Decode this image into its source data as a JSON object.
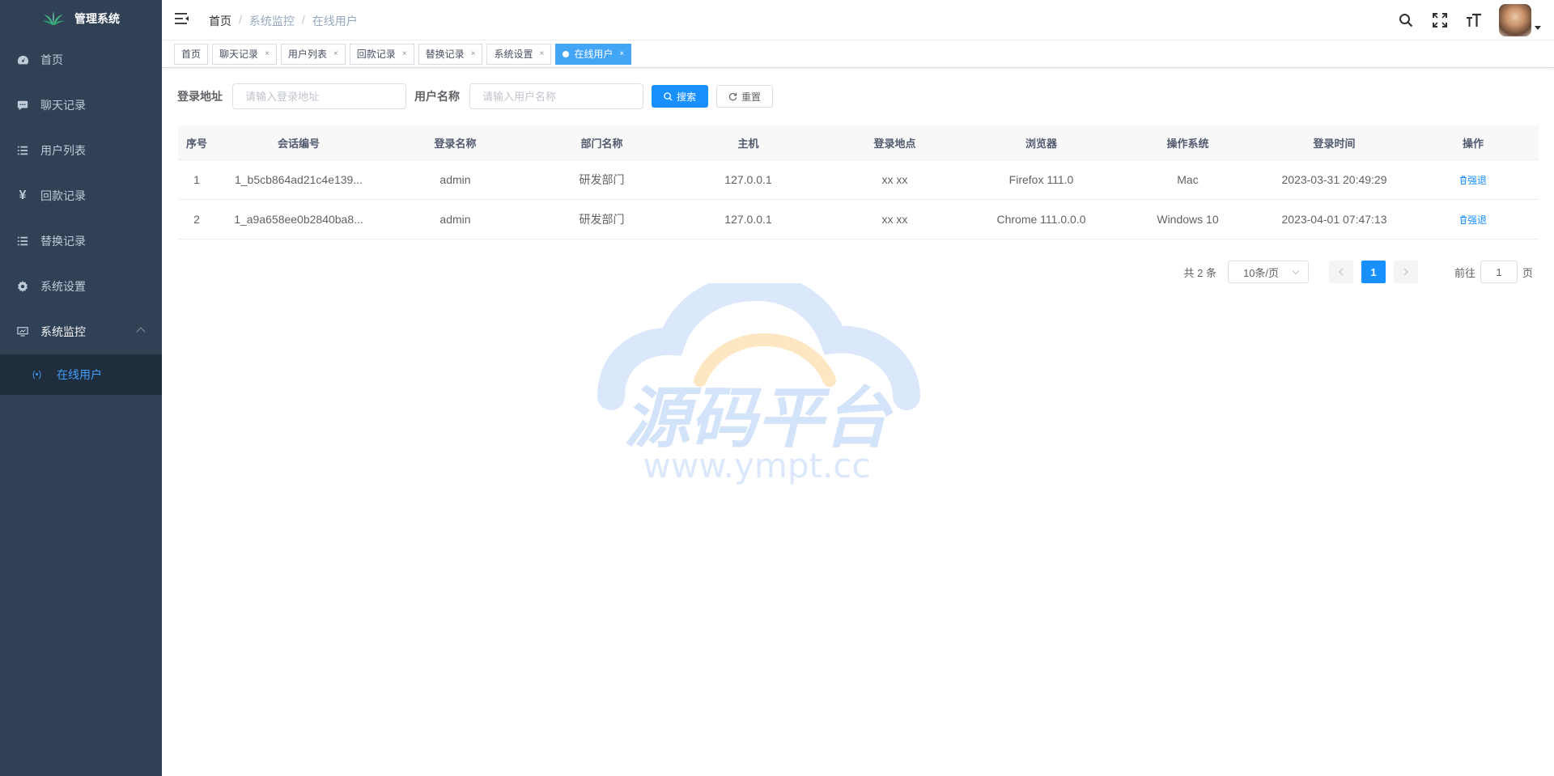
{
  "sidebar": {
    "logo_text": "管理系统",
    "items": [
      {
        "label": "首页",
        "icon": "dashboard-icon"
      },
      {
        "label": "聊天记录",
        "icon": "chat-bubble-icon"
      },
      {
        "label": "用户列表",
        "icon": "list-icon"
      },
      {
        "label": "回款记录",
        "icon": "yen-icon"
      },
      {
        "label": "替换记录",
        "icon": "list-icon"
      },
      {
        "label": "系统设置",
        "icon": "gear-icon"
      },
      {
        "label": "系统监控",
        "icon": "monitor-icon"
      }
    ],
    "submenu": {
      "label": "在线用户",
      "icon": "online-icon"
    }
  },
  "navbar": {
    "breadcrumb": [
      "首页",
      "系统监控",
      "在线用户"
    ]
  },
  "tags": [
    "首页",
    "聊天记录",
    "用户列表",
    "回款记录",
    "替换记录",
    "系统设置",
    "在线用户"
  ],
  "search": {
    "ip_label": "登录地址",
    "ip_placeholder": "请输入登录地址",
    "user_label": "用户名称",
    "user_placeholder": "请输入用户名称",
    "search_label": "搜索",
    "reset_label": "重置"
  },
  "table": {
    "columns": [
      "序号",
      "会话编号",
      "登录名称",
      "部门名称",
      "主机",
      "登录地点",
      "浏览器",
      "操作系统",
      "登录时间",
      "操作"
    ],
    "rows": [
      {
        "no": "1",
        "session": "1_b5cb864ad21c4e139...",
        "name": "admin",
        "dept": "研发部门",
        "host": "127.0.0.1",
        "location": "xx xx",
        "browser": "Firefox 111.0",
        "os": "Mac",
        "time": "2023-03-31 20:49:29",
        "action": "强退"
      },
      {
        "no": "2",
        "session": "1_a9a658ee0b2840ba8...",
        "name": "admin",
        "dept": "研发部门",
        "host": "127.0.0.1",
        "location": "xx xx",
        "browser": "Chrome 111.0.0.0",
        "os": "Windows 10",
        "time": "2023-04-01 07:47:13",
        "action": "强退"
      }
    ]
  },
  "pagination": {
    "total": "共 2 条",
    "page_size": "10条/页",
    "current": "1",
    "goto_label": "前往",
    "goto_value": "1",
    "page_suffix": "页"
  },
  "watermark": {
    "title": "源码平台",
    "url": "www.ympt.cc"
  },
  "colors": {
    "sidebar_bg": "#304156",
    "accent": "#1890ff",
    "active_tag": "#42a5f5"
  }
}
